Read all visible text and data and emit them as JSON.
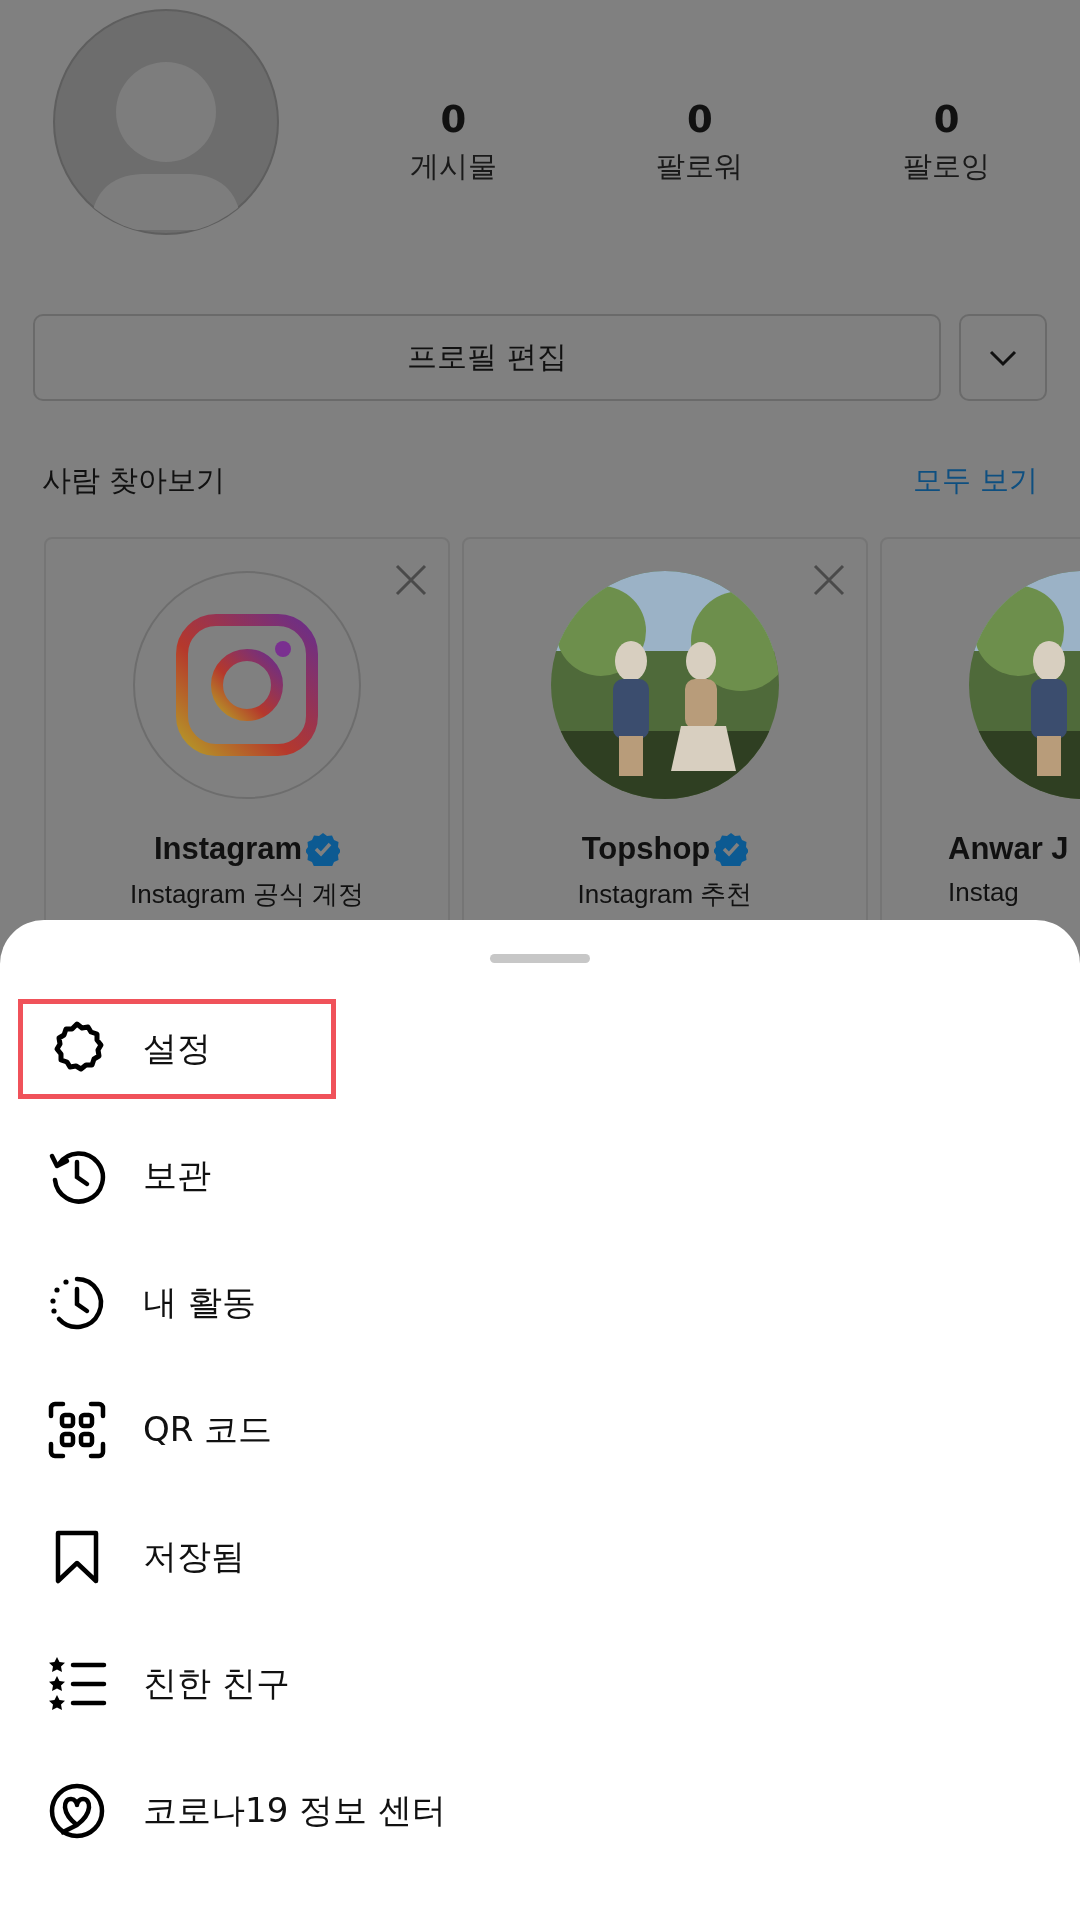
{
  "profile": {
    "stats": [
      {
        "count": "0",
        "label": "게시물"
      },
      {
        "count": "0",
        "label": "팔로워"
      },
      {
        "count": "0",
        "label": "팔로잉"
      }
    ],
    "edit_button": "프로필 편집"
  },
  "discover": {
    "title": "사람 찾아보기",
    "see_all": "모두 보기",
    "cards": [
      {
        "kind": "logo",
        "name": "Instagram",
        "verified": true,
        "subtitle": "Instagram 공식 계정",
        "dismissible": true
      },
      {
        "kind": "picture",
        "name": "Topshop",
        "verified": true,
        "subtitle": "Instagram 추천",
        "dismissible": true
      },
      {
        "kind": "picture",
        "name": "Anwar J",
        "verified": false,
        "subtitle": "Instag",
        "dismissible": false
      }
    ]
  },
  "menu": {
    "items": [
      {
        "kind": "gear",
        "label": "설정",
        "highlighted": true
      },
      {
        "kind": "history",
        "label": "보관",
        "highlighted": false
      },
      {
        "kind": "activity",
        "label": "내 활동",
        "highlighted": false
      },
      {
        "kind": "qr",
        "label": "QR 코드",
        "highlighted": false
      },
      {
        "kind": "bookmark",
        "label": "저장됨",
        "highlighted": false
      },
      {
        "kind": "friends",
        "label": "친한 친구",
        "highlighted": false
      },
      {
        "kind": "heart",
        "label": "코로나19 정보 센터",
        "highlighted": false
      }
    ]
  }
}
